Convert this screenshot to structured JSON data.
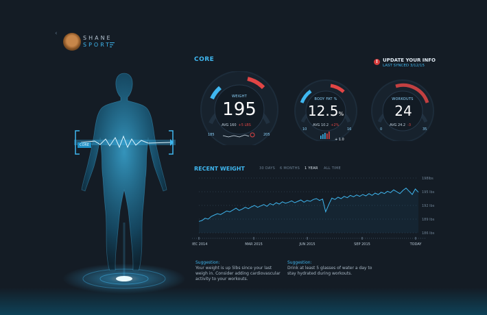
{
  "brand": {
    "line1": "SHANE",
    "line2": "SPORT"
  },
  "nav": {
    "back": "‹"
  },
  "section": {
    "title": "CORE"
  },
  "update": {
    "title": "UPDATE YOUR INFO",
    "subtitle": "LAST SYNCED 3/12/15",
    "icon": "!"
  },
  "body": {
    "tag": "CORE"
  },
  "gauges": {
    "weight": {
      "label": "WEIGHT",
      "value": "195",
      "avg": "AVG 160",
      "delta": "+5 LBS",
      "min": "185",
      "max": "205",
      "level": 0.55
    },
    "bodyfat": {
      "label": "BODY FAT %",
      "value": "12.5",
      "unit": "%",
      "avg": "AVG 10.2",
      "delta": "+2%",
      "min": "10",
      "max": "16",
      "extra": "+ 1.0",
      "level": 0.45
    },
    "workouts": {
      "label": "WORKOUTS",
      "value": "24",
      "avg": "AVG 24.2",
      "delta": "-3",
      "min": "0",
      "max": "35",
      "level": 0.7
    }
  },
  "recent": {
    "title": "RECENT WEIGHT",
    "tabs": [
      "30 DAYS",
      "6 MONTHS",
      "1 YEAR",
      "ALL TIME"
    ],
    "active_tab": "1 YEAR"
  },
  "chart_data": {
    "type": "line",
    "title": "RECENT WEIGHT",
    "x_labels": [
      "DEC 2014",
      "MAR 2015",
      "JUN 2015",
      "SEP 2015",
      "TODAY"
    ],
    "y_labels": [
      "198lbs",
      "195 lbs",
      "192 lbs",
      "189 lbs",
      "186 lbs"
    ],
    "ylim": [
      186,
      198
    ],
    "series": [
      {
        "values": [
          188.5,
          188.7,
          189.2,
          189.0,
          189.6,
          189.9,
          190.2,
          190.0,
          190.4,
          190.8,
          190.6,
          191.0,
          191.4,
          190.9,
          191.2,
          191.6,
          191.3,
          191.7,
          192.0,
          191.6,
          191.9,
          192.2,
          191.8,
          192.4,
          192.1,
          192.6,
          192.3,
          192.8,
          192.5,
          192.7,
          193.0,
          192.6,
          192.9,
          193.2,
          192.7,
          193.1,
          192.9,
          193.3,
          193.5,
          193.1,
          193.4,
          190.6,
          192.2,
          193.6,
          193.3,
          193.8,
          193.5,
          194.0,
          193.7,
          194.2,
          193.9,
          194.3,
          194.0,
          194.4,
          194.1,
          194.6,
          194.2,
          194.7,
          194.4,
          194.9,
          194.6,
          195.1,
          194.8,
          195.4,
          195.0,
          194.6,
          195.3,
          195.8,
          195.1,
          194.4,
          195.6,
          194.9
        ]
      }
    ],
    "grid": false
  },
  "suggestions": [
    {
      "title": "Suggestion:",
      "text": "Your weight is up 5lbs since your last weigh in. Consider adding cardiovascular activity to your workouts."
    },
    {
      "title": "Suggestion:",
      "text": "Drink at least 5 glasses of water a day to stay hydrated during workouts."
    }
  ],
  "colors": {
    "accent": "#3fb7f0",
    "warning": "#e14545",
    "background": "#141c25"
  }
}
